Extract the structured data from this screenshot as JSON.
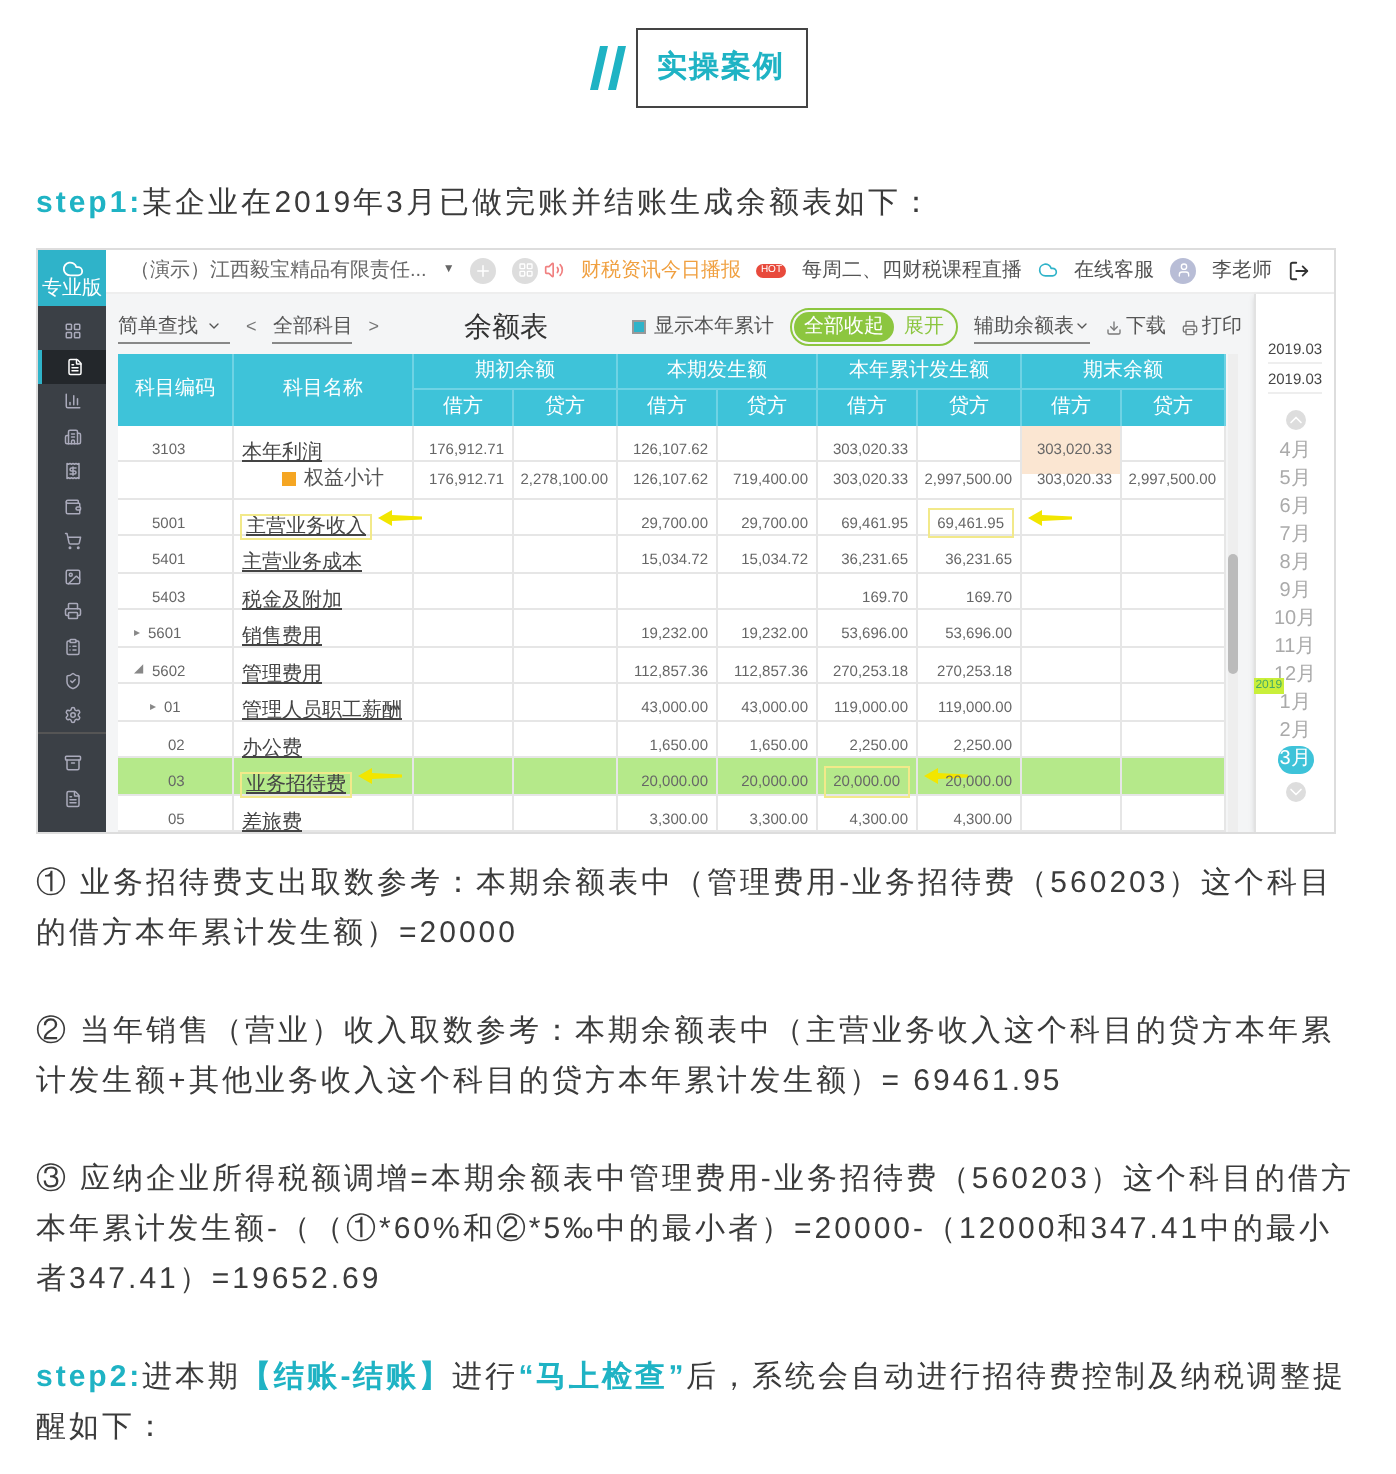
{
  "header_badge": {
    "text": "实操案例"
  },
  "step1": {
    "text": "**step1:**某企业在2019年3月已做完账并结账生成余额表如下："
  },
  "app": {
    "logo_label": "专业版",
    "sidebar": [
      {
        "selected": false
      },
      {
        "selected": true
      },
      {
        "selected": false
      },
      {
        "selected": false
      },
      {
        "selected": false
      },
      {
        "selected": false
      },
      {
        "selected": false
      },
      {
        "selected": false
      },
      {
        "selected": false
      },
      {
        "selected": false
      },
      {
        "selected": false
      },
      {
        "selected": false
      },
      {
        "selected": false
      },
      {
        "selected": false
      }
    ],
    "company": "（演示）江西毅宝精品有限责任...",
    "company_caret": "▼",
    "notice": "财税资讯今日播报",
    "hot_badge": "HOT",
    "live": "每周二、四财税课程直播",
    "service": "在线客服",
    "user": "李老师",
    "search_mode": "简单查找",
    "prev": "<",
    "subject_filter": "全部科目",
    "next": ">",
    "title": "余额表",
    "show_ytd": {
      "label": "显示本年累计",
      "checked": true
    },
    "toggle": [
      {
        "label": "全部收起",
        "selected": true
      },
      {
        "label": "展开",
        "selected": false
      }
    ],
    "aux_report": "辅助余额表",
    "download": "下载",
    "print": "打印",
    "groups": [
      "期初余额",
      "本期发生额",
      "本年累计发生额",
      "期末余额"
    ],
    "columns": [
      "科目编码",
      "科目名称"
    ],
    "sub_columns": [
      "借方",
      "贷方",
      "借方",
      "贷方",
      "借方",
      "贷方",
      "借方",
      "贷方"
    ],
    "rows": [
      {
        "kind": "account",
        "selected": false,
        "cells": [
          "3103",
          {
            "text": "本年利润"
          },
          "176,912.71",
          "",
          "126,107.62",
          "",
          "303,020.33",
          "",
          {
            "text": "303,020.33",
            "shaded": true
          },
          ""
        ]
      },
      {
        "kind": "subtotal",
        "selected": false,
        "cells": [
          "",
          {
            "text": "权益小计"
          },
          "176,912.71",
          "2,278,100.00",
          "126,107.62",
          "719,400.00",
          "303,020.33",
          "2,997,500.00",
          {
            "text": "303,020.33"
          },
          "2,997,500.00"
        ]
      },
      {
        "kind": "account",
        "selected": false,
        "cells": [
          "5001",
          {
            "text": "主营业务收入",
            "marked": true
          },
          "",
          "",
          "29,700.00",
          "29,700.00",
          "69,461.95",
          {
            "text": "69,461.95",
            "marked": true
          },
          "",
          ""
        ]
      },
      {
        "kind": "account",
        "selected": false,
        "cells": [
          "5401",
          {
            "text": "主营业务成本"
          },
          "",
          "",
          "15,034.72",
          "15,034.72",
          "36,231.65",
          "36,231.65",
          "",
          ""
        ]
      },
      {
        "kind": "account",
        "selected": false,
        "cells": [
          "5403",
          {
            "text": "税金及附加"
          },
          "",
          "",
          "",
          "",
          "169.70",
          "169.70",
          "",
          ""
        ]
      },
      {
        "kind": "account",
        "expander": "▸",
        "selected": false,
        "cells": [
          "5601",
          {
            "text": "销售费用"
          },
          "",
          "",
          "19,232.00",
          "19,232.00",
          "53,696.00",
          "53,696.00",
          "",
          ""
        ]
      },
      {
        "kind": "account",
        "expander": "◢",
        "selected": false,
        "cells": [
          "5602",
          {
            "text": "管理费用"
          },
          "",
          "",
          "112,857.36",
          "112,857.36",
          "270,253.18",
          "270,253.18",
          "",
          ""
        ]
      },
      {
        "kind": "child",
        "expander": "▸",
        "selected": false,
        "cells": [
          "01",
          {
            "text": "管理人员职工薪酬"
          },
          "",
          "",
          "43,000.00",
          "43,000.00",
          "119,000.00",
          "119,000.00",
          "",
          ""
        ]
      },
      {
        "kind": "child",
        "selected": false,
        "cells": [
          "02",
          {
            "text": "办公费"
          },
          "",
          "",
          "1,650.00",
          "1,650.00",
          "2,250.00",
          "2,250.00",
          "",
          ""
        ]
      },
      {
        "kind": "child",
        "selected": true,
        "cells": [
          "03",
          {
            "text": "业务招待费",
            "marked": true
          },
          "",
          "",
          "20,000.00",
          "20,000.00",
          {
            "text": "20,000.00",
            "marked": true
          },
          "20,000.00",
          "",
          ""
        ]
      },
      {
        "kind": "child",
        "selected": false,
        "cells": [
          "05",
          {
            "text": "差旅费"
          },
          "",
          "",
          "3,300.00",
          "3,300.00",
          "4,300.00",
          "4,300.00",
          "",
          ""
        ]
      }
    ],
    "periods": [
      "2019.03",
      "2019.03"
    ],
    "months": [
      {
        "label": "4月",
        "selected": false
      },
      {
        "label": "5月",
        "selected": false
      },
      {
        "label": "6月",
        "selected": false
      },
      {
        "label": "7月",
        "selected": false
      },
      {
        "label": "8月",
        "selected": false
      },
      {
        "label": "9月",
        "selected": false
      },
      {
        "label": "10月",
        "selected": false
      },
      {
        "label": "11月",
        "selected": false
      },
      {
        "label": "12月",
        "selected": false
      },
      {
        "label": "1月",
        "selected": false,
        "tag": "2019"
      },
      {
        "label": "2月",
        "selected": false
      },
      {
        "label": "3月",
        "selected": true
      }
    ]
  },
  "paragraphs": [
    "① 业务招待费支出取数参考：本期余额表中（管理费用-业务招待费（560203）这个科目的借方本年累计发生额）=20000",
    "② 当年销售（营业）收入取数参考：本期余额表中（主营业务收入这个科目的贷方本年累计发生额+其他业务收入这个科目的贷方本年累计发生额）= 69461.95",
    "③ 应纳企业所得税额调增=本期余额表中管理费用-业务招待费（560203）这个科目的借方本年累计发生额-（（①*60%和②*5‰中的最小者）=20000-（12000和347.41中的最小者347.41）=19652.69"
  ],
  "step2": {
    "text": "**step2:**进本期**【结账-结账】**进行**“马上检查”**后，系统会自动进行招待费控制及纳税调整提醒如下："
  }
}
